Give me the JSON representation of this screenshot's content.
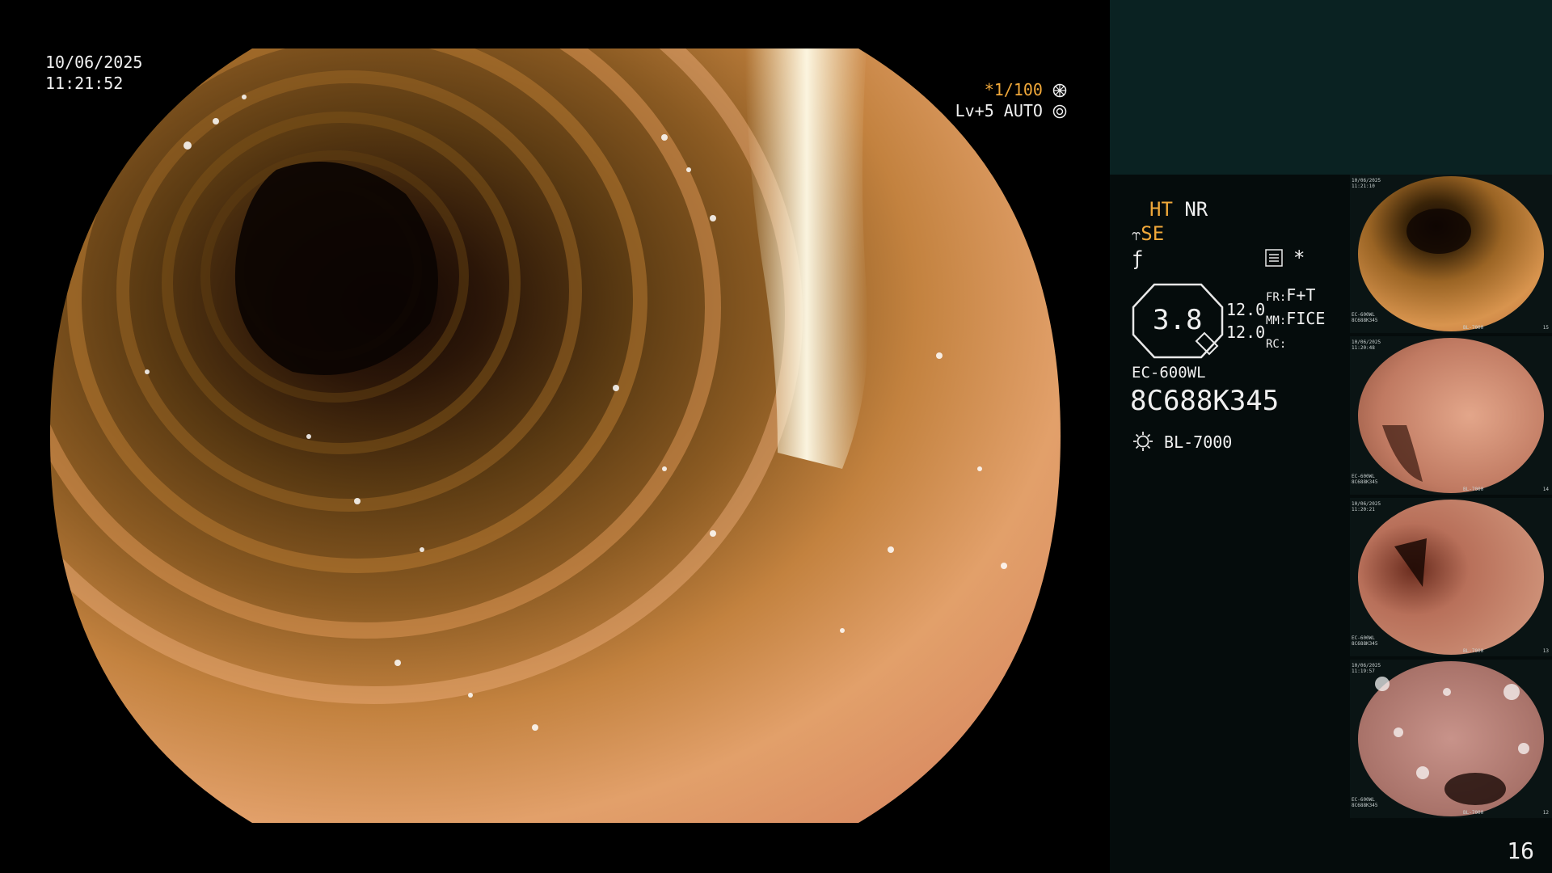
{
  "osd": {
    "date": "10/06/2025",
    "time": "11:21:52",
    "shutter": "*1/100",
    "level": "Lv+5 AUTO"
  },
  "panel": {
    "ht": "HT",
    "nr": "NR",
    "se": "SE",
    "zoom": "3.8",
    "val1": "12.0",
    "val2": "12.0",
    "fr_label": "FR:",
    "fr_value": "F+T",
    "mm_label": "MM:",
    "mm_value": "FICE",
    "rc_label": "RC:",
    "scope_model": "EC-600WL",
    "serial": "8C688K345",
    "light_source": "BL-7000",
    "page_number": "16"
  },
  "thumbnails": [
    {
      "date": "10/06/2025",
      "time": "11:21:10",
      "scope": "EC-600WL",
      "serial": "8C688K345",
      "light": "BL-7000",
      "index": "15"
    },
    {
      "date": "10/06/2025",
      "time": "11:20:48",
      "scope": "EC-600WL",
      "serial": "8C688K345",
      "light": "BL-7000",
      "index": "14"
    },
    {
      "date": "10/06/2025",
      "time": "11:20:21",
      "scope": "EC-600WL",
      "serial": "8C688K345",
      "light": "BL-7000",
      "index": "13"
    },
    {
      "date": "10/06/2025",
      "time": "11:19:57",
      "scope": "EC-600WL",
      "serial": "8C688K345",
      "light": "BL-7000",
      "index": "12"
    }
  ],
  "colors": {
    "accent_amber": "#f0a83a",
    "panel_top": "#0a2222",
    "panel_bottom": "#050c0c"
  },
  "icons": {
    "shutter": "aperture-icon",
    "auto": "iris-icon",
    "light": "lamp-icon",
    "structure": "structure-enhance-icon",
    "color": "color-enhance-icon",
    "menu": "menu-icon"
  }
}
